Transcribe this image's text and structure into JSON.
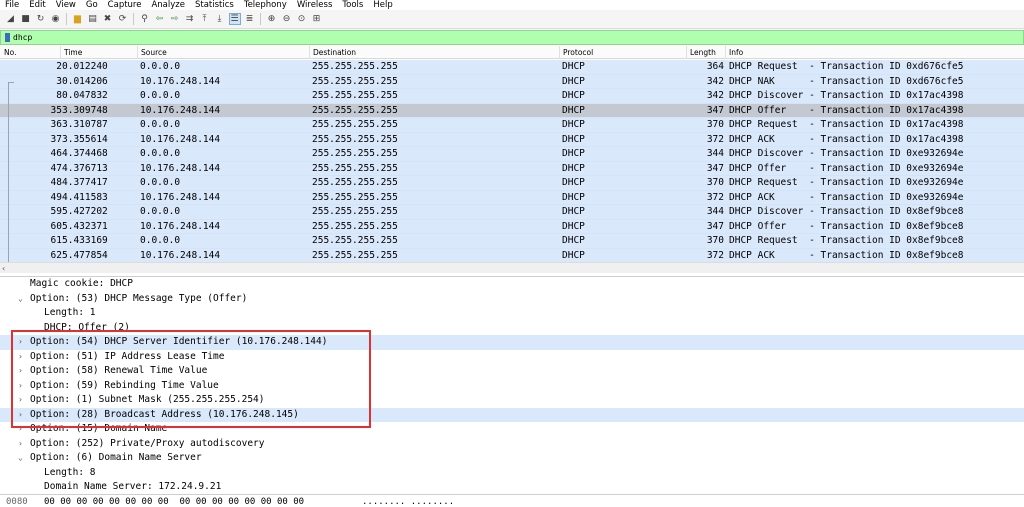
{
  "menu": [
    "File",
    "Edit",
    "View",
    "Go",
    "Capture",
    "Analyze",
    "Statistics",
    "Telephony",
    "Wireless",
    "Tools",
    "Help"
  ],
  "filter": {
    "value": "dhcp"
  },
  "columns": {
    "no": "No.",
    "time": "Time",
    "source": "Source",
    "destination": "Destination",
    "protocol": "Protocol",
    "length": "Length",
    "info": "Info"
  },
  "packets": [
    {
      "no": "2",
      "time": "0.012240",
      "src": "0.0.0.0",
      "dst": "255.255.255.255",
      "proto": "DHCP",
      "len": "364",
      "info": "DHCP Request  - Transaction ID 0xd676cfe5"
    },
    {
      "no": "3",
      "time": "0.014206",
      "src": "10.176.248.144",
      "dst": "255.255.255.255",
      "proto": "DHCP",
      "len": "342",
      "info": "DHCP NAK      - Transaction ID 0xd676cfe5"
    },
    {
      "no": "8",
      "time": "0.047832",
      "src": "0.0.0.0",
      "dst": "255.255.255.255",
      "proto": "DHCP",
      "len": "342",
      "info": "DHCP Discover - Transaction ID 0x17ac4398"
    },
    {
      "no": "35",
      "time": "3.309748",
      "src": "10.176.248.144",
      "dst": "255.255.255.255",
      "proto": "DHCP",
      "len": "347",
      "info": "DHCP Offer    - Transaction ID 0x17ac4398",
      "selected": true
    },
    {
      "no": "36",
      "time": "3.310787",
      "src": "0.0.0.0",
      "dst": "255.255.255.255",
      "proto": "DHCP",
      "len": "370",
      "info": "DHCP Request  - Transaction ID 0x17ac4398"
    },
    {
      "no": "37",
      "time": "3.355614",
      "src": "10.176.248.144",
      "dst": "255.255.255.255",
      "proto": "DHCP",
      "len": "372",
      "info": "DHCP ACK      - Transaction ID 0x17ac4398"
    },
    {
      "no": "46",
      "time": "4.374468",
      "src": "0.0.0.0",
      "dst": "255.255.255.255",
      "proto": "DHCP",
      "len": "344",
      "info": "DHCP Discover - Transaction ID 0xe932694e"
    },
    {
      "no": "47",
      "time": "4.376713",
      "src": "10.176.248.144",
      "dst": "255.255.255.255",
      "proto": "DHCP",
      "len": "347",
      "info": "DHCP Offer    - Transaction ID 0xe932694e"
    },
    {
      "no": "48",
      "time": "4.377417",
      "src": "0.0.0.0",
      "dst": "255.255.255.255",
      "proto": "DHCP",
      "len": "370",
      "info": "DHCP Request  - Transaction ID 0xe932694e"
    },
    {
      "no": "49",
      "time": "4.411583",
      "src": "10.176.248.144",
      "dst": "255.255.255.255",
      "proto": "DHCP",
      "len": "372",
      "info": "DHCP ACK      - Transaction ID 0xe932694e"
    },
    {
      "no": "59",
      "time": "5.427202",
      "src": "0.0.0.0",
      "dst": "255.255.255.255",
      "proto": "DHCP",
      "len": "344",
      "info": "DHCP Discover - Transaction ID 0x8ef9bce8"
    },
    {
      "no": "60",
      "time": "5.432371",
      "src": "10.176.248.144",
      "dst": "255.255.255.255",
      "proto": "DHCP",
      "len": "347",
      "info": "DHCP Offer    - Transaction ID 0x8ef9bce8"
    },
    {
      "no": "61",
      "time": "5.433169",
      "src": "0.0.0.0",
      "dst": "255.255.255.255",
      "proto": "DHCP",
      "len": "370",
      "info": "DHCP Request  - Transaction ID 0x8ef9bce8"
    },
    {
      "no": "62",
      "time": "5.477854",
      "src": "10.176.248.144",
      "dst": "255.255.255.255",
      "proto": "DHCP",
      "len": "372",
      "info": "DHCP ACK      - Transaction ID 0x8ef9bce8"
    }
  ],
  "details": [
    {
      "text": "Magic cookie: DHCP",
      "indent": 2,
      "arrow": ""
    },
    {
      "text": "Option: (53) DHCP Message Type (Offer)",
      "indent": 2,
      "arrow": "expanded"
    },
    {
      "text": "Length: 1",
      "indent": 3,
      "arrow": ""
    },
    {
      "text": "DHCP: Offer (2)",
      "indent": 3,
      "arrow": ""
    },
    {
      "text": "Option: (54) DHCP Server Identifier (10.176.248.144)",
      "indent": 2,
      "arrow": "collapsed",
      "highlight": true
    },
    {
      "text": "Option: (51) IP Address Lease Time",
      "indent": 2,
      "arrow": "collapsed"
    },
    {
      "text": "Option: (58) Renewal Time Value",
      "indent": 2,
      "arrow": "collapsed"
    },
    {
      "text": "Option: (59) Rebinding Time Value",
      "indent": 2,
      "arrow": "collapsed"
    },
    {
      "text": "Option: (1) Subnet Mask (255.255.255.254)",
      "indent": 2,
      "arrow": "collapsed"
    },
    {
      "text": "Option: (28) Broadcast Address (10.176.248.145)",
      "indent": 2,
      "arrow": "collapsed",
      "highlight": true
    },
    {
      "text": "Option: (15) Domain Name",
      "indent": 2,
      "arrow": "collapsed"
    },
    {
      "text": "Option: (252) Private/Proxy autodiscovery",
      "indent": 2,
      "arrow": "collapsed"
    },
    {
      "text": "Option: (6) Domain Name Server",
      "indent": 2,
      "arrow": "expanded"
    },
    {
      "text": "Length: 8",
      "indent": 3,
      "arrow": ""
    },
    {
      "text": "Domain Name Server: 172.24.9.21",
      "indent": 3,
      "arrow": ""
    }
  ],
  "bytes": {
    "offset": "0080",
    "hex": "00 00 00 00 00 00 00 00  00 00 00 00 00 00 00 00",
    "ascii": "........ ........"
  },
  "colors": {
    "row_bg": "#dae8fb",
    "selected_bg": "#c3c8d1",
    "filter_bg": "#afffaf",
    "annotation": "#e03030"
  }
}
